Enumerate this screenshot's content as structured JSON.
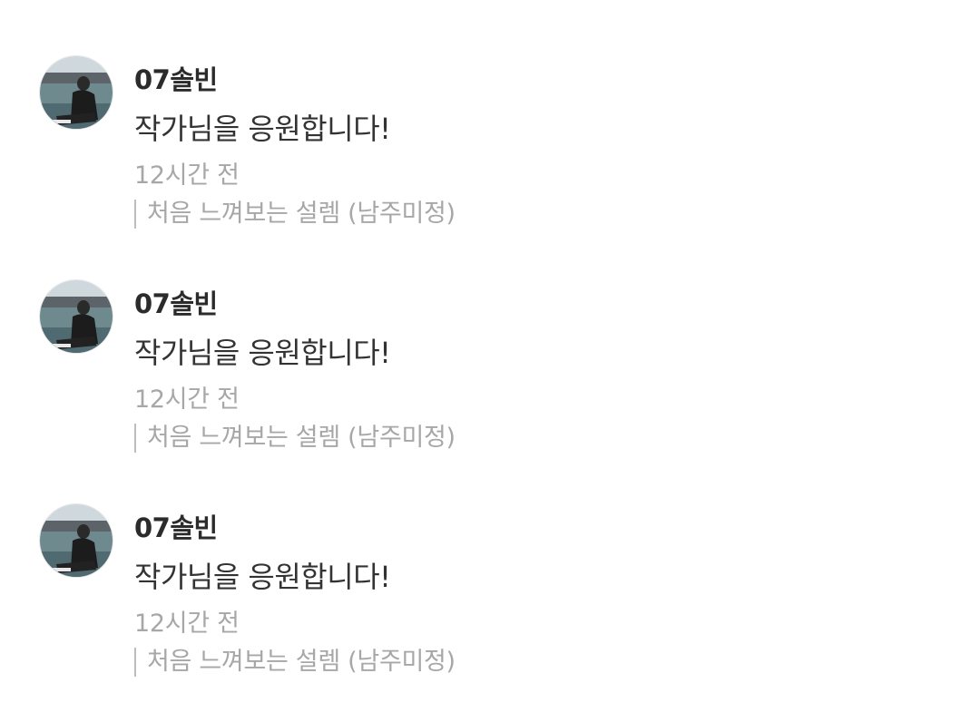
{
  "comments": [
    {
      "author": "07솔빈",
      "text": "작가님을 응원합니다!",
      "time": "12시간 전",
      "work_title": "처음 느껴보는 설렘 (남주미정)",
      "avatar_icon": "user-photo-avatar"
    },
    {
      "author": "07솔빈",
      "text": "작가님을 응원합니다!",
      "time": "12시간 전",
      "work_title": "처음 느껴보는 설렘 (남주미정)",
      "avatar_icon": "user-photo-avatar"
    },
    {
      "author": "07솔빈",
      "text": "작가님을 응원합니다!",
      "time": "12시간 전",
      "work_title": "처음 느껴보는 설렘 (남주미정)",
      "avatar_icon": "user-photo-avatar"
    }
  ],
  "colors": {
    "author_text": "#2b2b2b",
    "body_text": "#333333",
    "meta_text": "#a7a7a7",
    "divider_bar": "#bdbdbd",
    "background": "#ffffff"
  }
}
